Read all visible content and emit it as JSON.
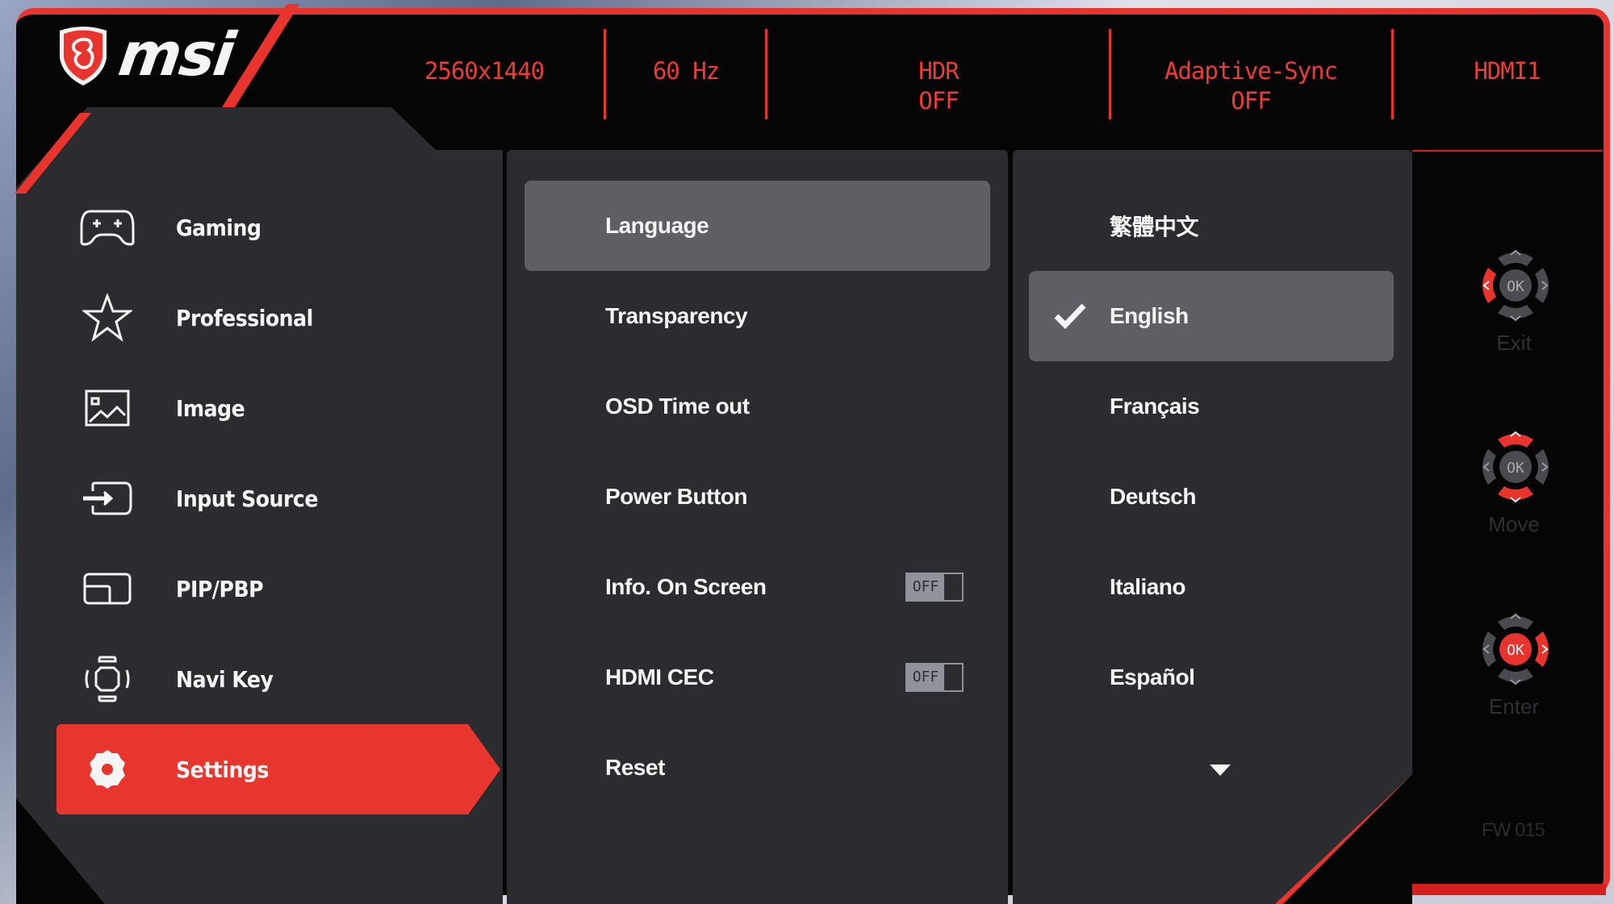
{
  "brand": {
    "logo": "msi-dragon-shield-icon",
    "name": "msi"
  },
  "colors": {
    "accent": "#e8342c",
    "panel": "#2b2c30",
    "highlight": "#5d5f64",
    "background": "#050506"
  },
  "header": {
    "status": [
      {
        "label": "2560x1440"
      },
      {
        "label": "60 Hz"
      },
      {
        "label": "HDR",
        "value": "OFF"
      },
      {
        "label": "Adaptive-Sync",
        "value": "OFF"
      },
      {
        "label": "HDMI1"
      }
    ]
  },
  "sidebar": {
    "items": [
      {
        "label": "Gaming",
        "icon": "gamepad-icon"
      },
      {
        "label": "Professional",
        "icon": "star-icon"
      },
      {
        "label": "Image",
        "icon": "image-icon"
      },
      {
        "label": "Input Source",
        "icon": "input-source-icon"
      },
      {
        "label": "PIP/PBP",
        "icon": "pip-icon"
      },
      {
        "label": "Navi Key",
        "icon": "navi-key-icon"
      },
      {
        "label": "Settings",
        "icon": "gear-icon",
        "active": true
      }
    ]
  },
  "settings": {
    "items": [
      {
        "label": "Language",
        "selected": true
      },
      {
        "label": "Transparency"
      },
      {
        "label": "OSD Time out"
      },
      {
        "label": "Power Button"
      },
      {
        "label": "Info. On Screen",
        "toggle": "OFF"
      },
      {
        "label": "HDMI CEC",
        "toggle": "OFF"
      },
      {
        "label": "Reset"
      }
    ]
  },
  "language": {
    "options": [
      {
        "label": "繁體中文"
      },
      {
        "label": "English",
        "checked": true
      },
      {
        "label": "Français"
      },
      {
        "label": "Deutsch"
      },
      {
        "label": "Italiano"
      },
      {
        "label": "Español"
      }
    ],
    "more_icon": "triangle-down-icon"
  },
  "key_guide": {
    "ok_text": "OK",
    "items": [
      {
        "label": "Exit",
        "active_direction": "left"
      },
      {
        "label": "Move",
        "active_direction": "up-down"
      },
      {
        "label": "Enter",
        "active_direction": "ok-right"
      }
    ]
  },
  "firmware": "FW 015"
}
